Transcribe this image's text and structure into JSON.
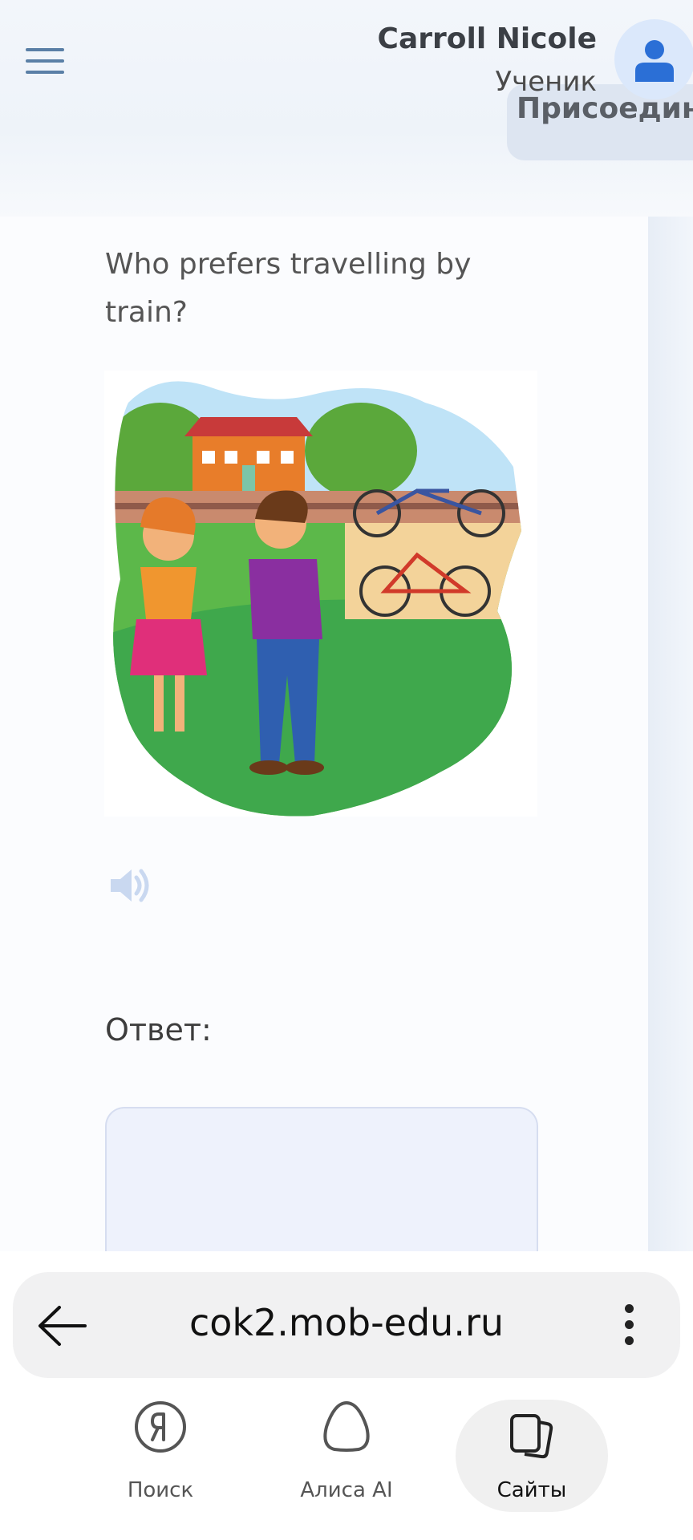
{
  "header": {
    "user_name": "Carroll Nicole",
    "user_role": "Ученик",
    "join_label": "Присоединиться"
  },
  "task": {
    "question": "Who prefers travelling by train?",
    "answer_label": "Ответ:"
  },
  "browser": {
    "url": "cok2.mob-edu.ru",
    "nav": [
      {
        "label": "Поиск",
        "icon": "yandex-icon"
      },
      {
        "label": "Алиса AI",
        "icon": "alice-icon"
      },
      {
        "label": "Сайты",
        "icon": "sites-icon"
      }
    ],
    "active_nav": "Сайты"
  },
  "colors": {
    "accent": "#5a7fa6",
    "avatar": "#2b6fd6"
  }
}
